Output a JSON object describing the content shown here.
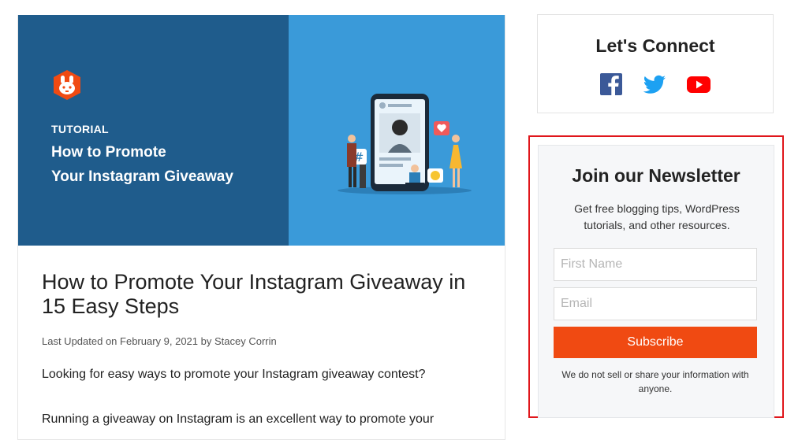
{
  "hero": {
    "kicker": "TUTORIAL",
    "title_line1": "How to Promote",
    "title_line2": "Your Instagram Giveaway",
    "colors": {
      "left_panel": "#1f5c8c",
      "right_panel": "#3a9ad9",
      "logo": "#f04a12"
    },
    "icons": [
      "rafflepress-logo-icon",
      "phone-social-illustration"
    ]
  },
  "post": {
    "title": "How to Promote Your Instagram Giveaway in 15 Easy Steps",
    "meta_prefix": "Last Updated on February 9, 2021 by ",
    "author": "Stacey Corrin",
    "paragraph1": "Looking for easy ways to promote your Instagram giveaway contest?",
    "paragraph2": "Running a giveaway on Instagram is an excellent way to promote your"
  },
  "connect": {
    "title": "Let's Connect",
    "icons": [
      "facebook-icon",
      "twitter-icon",
      "youtube-icon"
    ],
    "colors": {
      "facebook": "#3b5998",
      "twitter": "#1da1f2",
      "youtube": "#ff0000"
    }
  },
  "newsletter": {
    "title": "Join our Newsletter",
    "description": "Get free blogging tips, WordPress tutorials, and other resources.",
    "first_name_placeholder": "First Name",
    "email_placeholder": "Email",
    "button_label": "Subscribe",
    "note": "We do not sell or share your information with anyone.",
    "colors": {
      "button": "#f04a12",
      "highlight": "#e0161b"
    }
  }
}
